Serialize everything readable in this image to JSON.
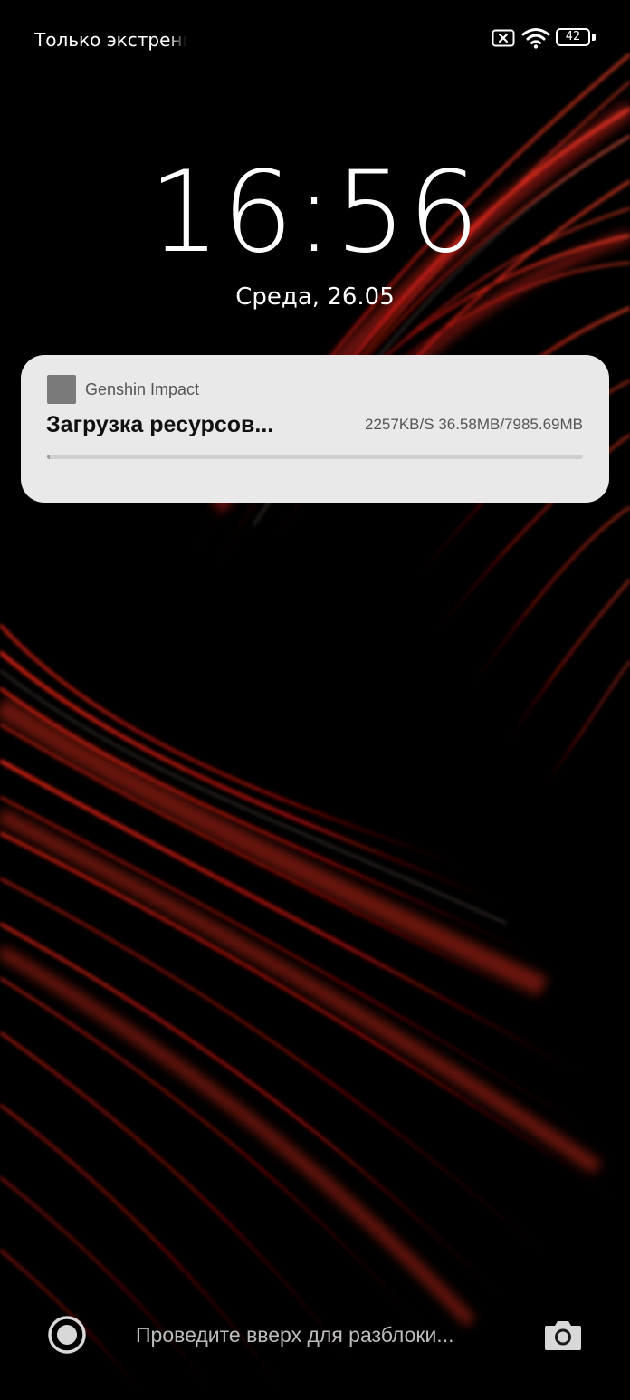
{
  "status_bar": {
    "carrier_text": "Только экстренн",
    "battery_level": "42",
    "icons": [
      "no-sim-icon",
      "wifi-icon",
      "battery-icon"
    ]
  },
  "lock_screen": {
    "time": "16:56",
    "date": "Среда, 26.05"
  },
  "notification": {
    "app_name": "Genshin Impact",
    "title": "Загрузка ресурсов...",
    "progress_text": "2257KB/S 36.58MB/7985.69MB",
    "progress_fraction": 0.0046
  },
  "bottom_bar": {
    "unlock_hint": "Проведите вверх для разблоки...",
    "left_icon": "record-icon",
    "right_icon": "camera-icon"
  },
  "colors": {
    "background": "#000000",
    "wallpaper_accent": "#d81b16",
    "notification_bg": "#e9e9e9"
  }
}
